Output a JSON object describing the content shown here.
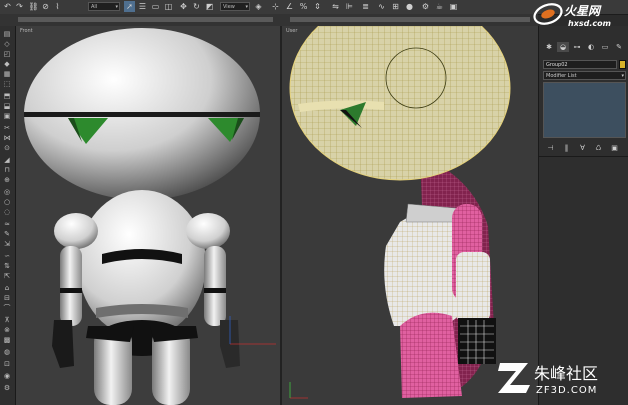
{
  "toolbar": {
    "selection_filter": "All",
    "reference_coord": "View"
  },
  "viewports": {
    "left_label": "Front",
    "right_label": "User"
  },
  "command_panel": {
    "object_name": "Group02",
    "object_color": "#d8b32a",
    "modifier_list": "Modifier List"
  },
  "watermarks": {
    "top_logo_text": "火星网",
    "top_logo_url": "hxsd.com",
    "bottom_logo_text": "朱峰社区",
    "bottom_logo_url": "ZF3D.COM"
  },
  "icons": [
    "undo-icon",
    "redo-icon",
    "link-icon",
    "unlink-icon",
    "bind-icon",
    "select-icon",
    "select-by-name-icon",
    "region-select-icon",
    "window-crossing-icon",
    "move-icon",
    "rotate-icon",
    "scale-icon",
    "pivot-icon",
    "snap-icon",
    "angle-snap-icon",
    "percent-snap-icon",
    "spinner-snap-icon",
    "mirror-icon",
    "align-icon",
    "layer-icon",
    "curve-editor-icon",
    "schematic-icon",
    "material-editor-icon",
    "render-setup-icon",
    "render-icon"
  ]
}
